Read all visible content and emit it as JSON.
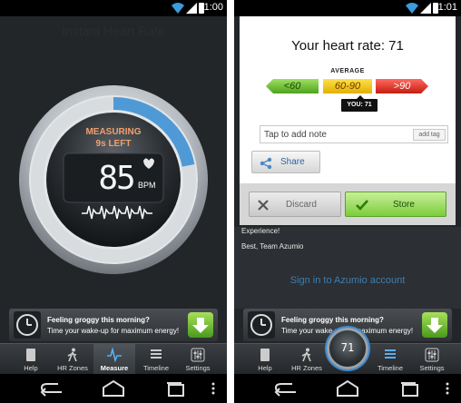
{
  "left": {
    "status_time": "1:00",
    "app_title": "Instant Heart Rate",
    "measuring_label": "MEASURING",
    "time_left": "9s LEFT",
    "bpm_value": "85",
    "bpm_unit": "BPM",
    "gauge_progress": 0.22,
    "ad": {
      "line1": "Feeling groggy this morning?",
      "line2": "Time your wake-up for maximum energy!"
    },
    "tabs": [
      {
        "label": "Help",
        "icon": "help-book-icon"
      },
      {
        "label": "HR Zones",
        "icon": "walking-person-icon"
      },
      {
        "label": "Measure",
        "icon": "pulse-wave-icon",
        "active": true
      },
      {
        "label": "Timeline",
        "icon": "list-icon"
      },
      {
        "label": "Settings",
        "icon": "sliders-icon"
      }
    ]
  },
  "right": {
    "status_time": "1:01",
    "dialog": {
      "title": "Your heart rate: 71",
      "average_label": "AVERAGE",
      "scale": {
        "low": "<60",
        "mid": "60-90",
        "high": ">90"
      },
      "you_label": "YOU: 71",
      "note_placeholder": "Tap to add note",
      "add_tag": "add tag",
      "share": "Share",
      "discard": "Discard",
      "store": "Store"
    },
    "background": {
      "line1": "Experience!",
      "line2": "Best, Team Azumio",
      "link": "Sign in to Azumio account"
    },
    "mini_gauge_value": "71",
    "ad": {
      "line1": "Feeling groggy this morning?",
      "line2": "Time your wake-up for maximum energy!"
    },
    "tabs": [
      {
        "label": "Help",
        "icon": "help-book-icon"
      },
      {
        "label": "HR Zones",
        "icon": "walking-person-icon"
      },
      {
        "label": "",
        "icon": "measure-gauge-icon"
      },
      {
        "label": "Timeline",
        "icon": "list-icon",
        "active": true
      },
      {
        "label": "Settings",
        "icon": "sliders-icon"
      }
    ]
  },
  "colors": {
    "accent_blue": "#3c8bd2",
    "measuring_orange": "#f2a06e",
    "low_green": "#4fa31c",
    "mid_yellow": "#e0b000",
    "high_red": "#c41d12",
    "store_green": "#7ccd3a",
    "link_blue": "#3c7fb0"
  }
}
